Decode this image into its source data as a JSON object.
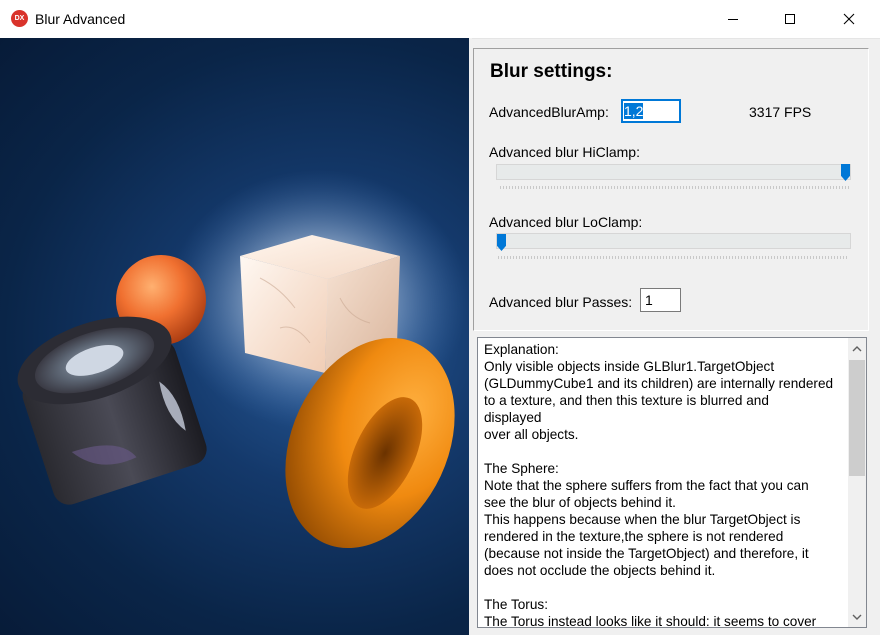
{
  "window": {
    "title": "Blur Advanced",
    "icon_text": "DX",
    "icon_color": "#d9332b"
  },
  "settings": {
    "title": "Blur settings:",
    "amp_label": "AdvancedBlurAmp:",
    "amp_value": "1,2",
    "fps": "3317 FPS",
    "hiclamp_label": "Advanced blur HiClamp:",
    "hiclamp_level": 1.0,
    "loclamp_label": "Advanced blur LoClamp:",
    "loclamp_level": 0.0,
    "passes_label": "Advanced blur Passes:",
    "passes_value": "1"
  },
  "memo": {
    "lines": [
      "Explanation:",
      "Only visible objects inside GLBlur1.TargetObject",
      "(GLDummyCube1 and its children) are internally rendered",
      "to a texture, and then this texture is blurred and",
      "displayed",
      "over all objects.",
      "",
      "The Sphere:",
      "Note that the sphere suffers from the fact that you can",
      "see the blur of objects behind it.",
      "This happens because when the blur TargetObject is",
      "rendered in the texture,the sphere is not rendered",
      "(because not inside the TargetObject) and therefore, it",
      "does not occlude the objects behind it.",
      "",
      "The Torus:",
      "The Torus instead looks like it should: it seems to cover"
    ]
  },
  "colors": {
    "accent": "#0078d7",
    "viewport_bg": "#0a2548",
    "torus": "#ff8c00",
    "sphere": "#e8622a"
  }
}
